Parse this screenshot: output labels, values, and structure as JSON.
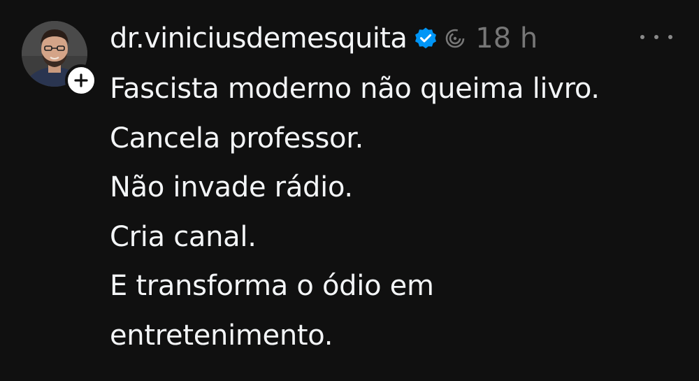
{
  "post": {
    "username": "dr.viniciusdemesquita",
    "timestamp": "18 h",
    "lines": [
      "Fascista moderno não queima livro.",
      "Cancela professor.",
      "Não invade rádio.",
      "Cria canal.",
      "E transforma o ódio em",
      "entretenimento."
    ]
  },
  "icons": {
    "verified": "verified-badge-icon",
    "ai_label": "ai-spiral-icon",
    "more": "more-options-icon",
    "follow": "plus-icon"
  },
  "colors": {
    "background": "#101010",
    "text": "#f3f5f7",
    "muted": "#777777",
    "verified": "#0095f6"
  }
}
